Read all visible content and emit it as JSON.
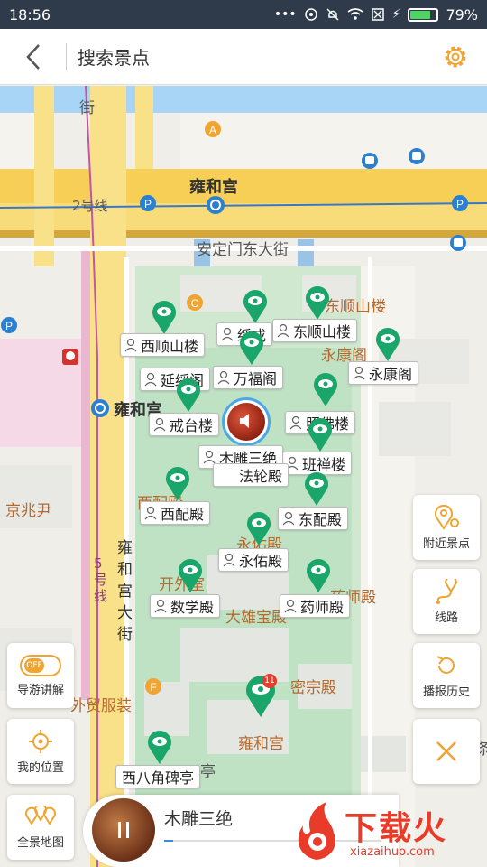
{
  "status": {
    "time": "18:56",
    "battery": "79%",
    "battery_level": 0.79
  },
  "header": {
    "title": "搜索景点"
  },
  "map_labels": {
    "yonghegong_top": "雍和宫",
    "line2": "2号线",
    "andingmen": "安定门东大街",
    "yonghe_station": "雍和宫",
    "jingzhaoyin": "京兆尹",
    "line5": "5号线",
    "yonghegong_st": "雍和宫大街",
    "waimaofuzhuang": "外贸服装",
    "mizongdian": "密宗殿",
    "yonghegong_bottom": "雍和宫",
    "daxiongbaodian": "大雄宝殿",
    "yaoshidian_bg": "药师殿",
    "yongyoudian_bg": "永佑殿",
    "xipeidian_bg": "西配殿",
    "kaixing": "开外室",
    "dongshunshan_bg": "东顺山楼",
    "yongkang_bg": "永康阁",
    "jie": "街",
    "ting": "亭",
    "tiao": "条"
  },
  "pois": [
    {
      "name": "西顺山楼"
    },
    {
      "name": "东顺山楼"
    },
    {
      "name": "绥成"
    },
    {
      "name": "延绥阁"
    },
    {
      "name": "万福阁"
    },
    {
      "name": "永康阁"
    },
    {
      "name": "戒台楼"
    },
    {
      "name": "照佛楼"
    },
    {
      "name": "班禅楼"
    },
    {
      "name": "木雕三绝"
    },
    {
      "name": "法轮殿"
    },
    {
      "name": "西配殿"
    },
    {
      "name": "东配殿"
    },
    {
      "name": "永佑殿"
    },
    {
      "name": "数学殿"
    },
    {
      "name": "药师殿"
    },
    {
      "name": "西八角碑亭"
    }
  ],
  "side_buttons": {
    "nearby": "附近景点",
    "route": "线路",
    "history": "播报历史"
  },
  "left_buttons": {
    "guide_toggle": "OFF",
    "guide": "导游讲解",
    "location": "我的位置",
    "fullmap": "全景地图"
  },
  "badge": "11",
  "player": {
    "name": "木雕三绝",
    "progress": 0.04
  },
  "watermark": {
    "text": "下载火",
    "sub": "xiazaihuo.com"
  },
  "colors": {
    "pin": "#1aa56a",
    "accent": "#f0a431",
    "player_bar": "#3a8ed8",
    "watermark": "#e83b2a"
  }
}
